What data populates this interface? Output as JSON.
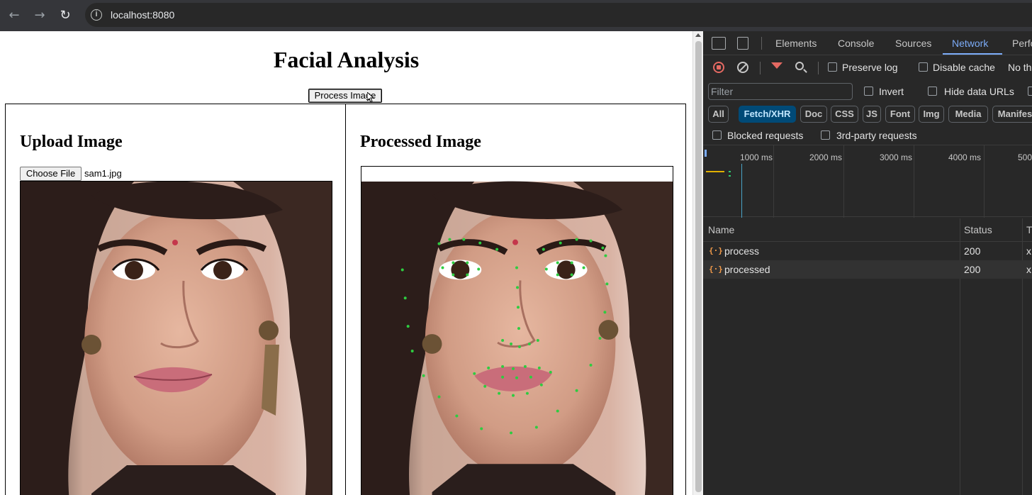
{
  "browser": {
    "url": "localhost:8080"
  },
  "page": {
    "title": "Facial Analysis",
    "process_button": "Process Image",
    "upload_heading": "Upload Image",
    "choose_file_button": "Choose File",
    "file_name": "sam1.jpg",
    "processed_heading": "Processed Image"
  },
  "devtools": {
    "tabs": [
      "Elements",
      "Console",
      "Sources",
      "Network",
      "Perfo"
    ],
    "active_tab": "Network",
    "preserve_log": "Preserve log",
    "disable_cache": "Disable cache",
    "throttle": "No th",
    "filter_placeholder": "Filter",
    "invert": "Invert",
    "hide_data_urls": "Hide data URLs",
    "chips": [
      "All",
      "Fetch/XHR",
      "Doc",
      "CSS",
      "JS",
      "Font",
      "Img",
      "Media",
      "Manifes"
    ],
    "active_chip": "Fetch/XHR",
    "blocked_requests": "Blocked requests",
    "third_party": "3rd-party requests",
    "timeline_ticks": [
      "1000 ms",
      "2000 ms",
      "3000 ms",
      "4000 ms",
      "500"
    ],
    "columns": [
      "Name",
      "Status",
      "T"
    ],
    "rows": [
      {
        "name": "process",
        "status": "200",
        "type": "x"
      },
      {
        "name": "processed",
        "status": "200",
        "type": "x"
      }
    ],
    "colors": {
      "accent": "#7cacf8",
      "record": "#e46962",
      "chip_active": "#004a77"
    }
  }
}
